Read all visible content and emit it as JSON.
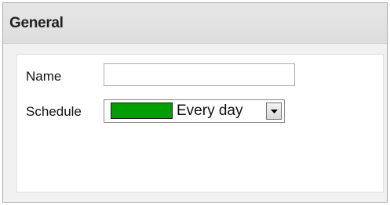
{
  "section": {
    "title": "General"
  },
  "form": {
    "name_label": "Name",
    "name_value": "",
    "schedule_label": "Schedule",
    "schedule_value": "Every day",
    "schedule_color": "#009e00"
  },
  "icons": {
    "dropdown": "chevron-down-icon"
  }
}
